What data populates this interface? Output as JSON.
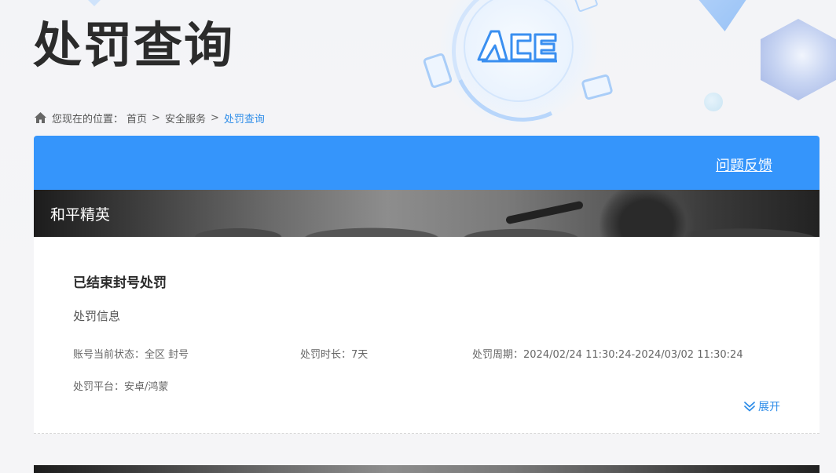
{
  "header": {
    "title": "处罚查询",
    "logo_text": "ACE"
  },
  "breadcrumb": {
    "prefix": "您现在的位置：",
    "home": "首页",
    "separator": ">",
    "section": "安全服务",
    "current": "处罚查询"
  },
  "panel": {
    "feedback_label": "问题反馈",
    "game_name": "和平精英"
  },
  "record": {
    "title": "已结束封号处罚",
    "section_label": "处罚信息",
    "status_label": "账号当前状态：",
    "status_value": "全区 封号",
    "duration_label": "处罚时长：",
    "duration_value": "7天",
    "period_label": "处罚周期：",
    "period_value": "2024/02/24 11:30:24-2024/03/02 11:30:24",
    "platform_label": "处罚平台：",
    "platform_value": "安卓/鸿蒙",
    "expand_label": "展开"
  },
  "colors": {
    "accent": "#3595fb",
    "link": "#2f8de8",
    "title_text": "#2b2b2b"
  }
}
